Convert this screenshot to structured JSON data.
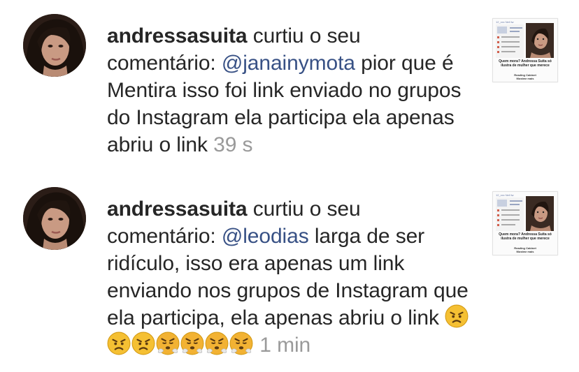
{
  "notifications": [
    {
      "username": "andressasuita",
      "action": " curtiu o seu comentário: ",
      "mention": "@janainymota",
      "comment": " pior que é Mentira isso foi link enviado no grupos do Instagram ela participa ela apenas abriu o link",
      "time": "39 s",
      "thumbnail": {
        "mini_label": "12_xxx Nell lw",
        "caption": "Quem mora? Andressa Suita só ilustra de mulher que merece",
        "handle": "Reading Cabinet",
        "sub": "Mostrar mais"
      }
    },
    {
      "username": "andressasuita",
      "action": " curtiu o seu comentário: ",
      "mention": "@leodias",
      "comment": " larga de ser ridículo, isso era apenas um link enviando nos grupos de Instagram que ela participa, ela apenas abriu o link",
      "emojis": [
        "angry-face",
        "angry-face",
        "angry-face",
        "steam-face",
        "steam-face",
        "steam-face",
        "steam-face"
      ],
      "time": "1 min",
      "thumbnail": {
        "mini_label": "12_xxx Nell lw",
        "caption": "Quem mora? Andressa Suita só ilustra de mulher que merece",
        "handle": "Reading Cabinet",
        "sub": "Mostrar mais"
      }
    }
  ],
  "colors": {
    "mention": "#385185",
    "time": "#9a9a9a",
    "text": "#262626"
  }
}
